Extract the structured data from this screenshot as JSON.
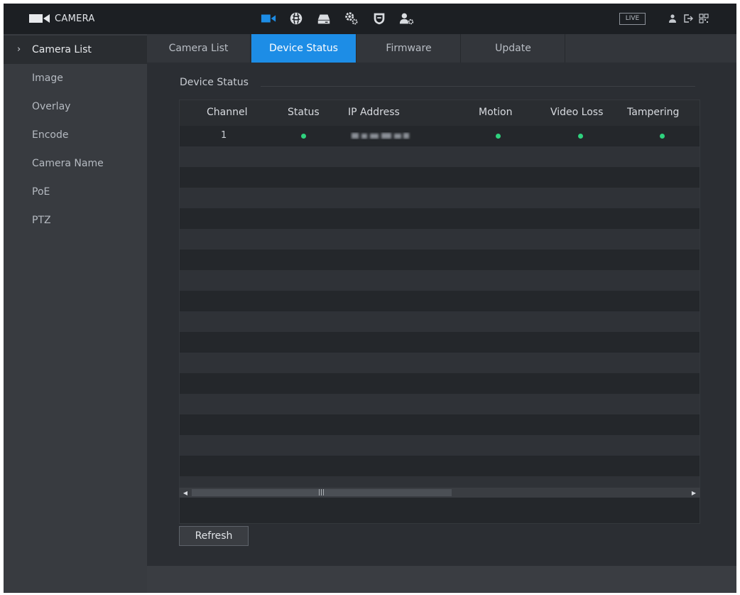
{
  "header": {
    "title": "CAMERA",
    "nav_icons": [
      "camera-icon",
      "network-icon",
      "storage-icon",
      "system-icon",
      "security-icon",
      "account-icon"
    ],
    "live_label": "LIVE",
    "system_icons": [
      "user-icon",
      "logout-icon",
      "qr-icon"
    ]
  },
  "sidebar": {
    "items": [
      {
        "label": "Camera List",
        "active": true
      },
      {
        "label": "Image"
      },
      {
        "label": "Overlay"
      },
      {
        "label": "Encode"
      },
      {
        "label": "Camera Name"
      },
      {
        "label": "PoE"
      },
      {
        "label": "PTZ"
      }
    ]
  },
  "tabs": [
    {
      "label": "Camera List"
    },
    {
      "label": "Device Status",
      "active": true
    },
    {
      "label": "Firmware"
    },
    {
      "label": "Update"
    }
  ],
  "main": {
    "section_title": "Device Status",
    "columns": [
      "Channel",
      "Status",
      "IP Address",
      "Motion",
      "Video Loss",
      "Tampering"
    ],
    "rows": [
      {
        "channel": "1",
        "status": "online",
        "ip": "",
        "motion": "normal",
        "video_loss": "normal",
        "tampering": "normal"
      }
    ],
    "refresh_label": "Refresh"
  },
  "colors": {
    "accent": "#1d8de6",
    "status_ok": "#2fd27e"
  }
}
